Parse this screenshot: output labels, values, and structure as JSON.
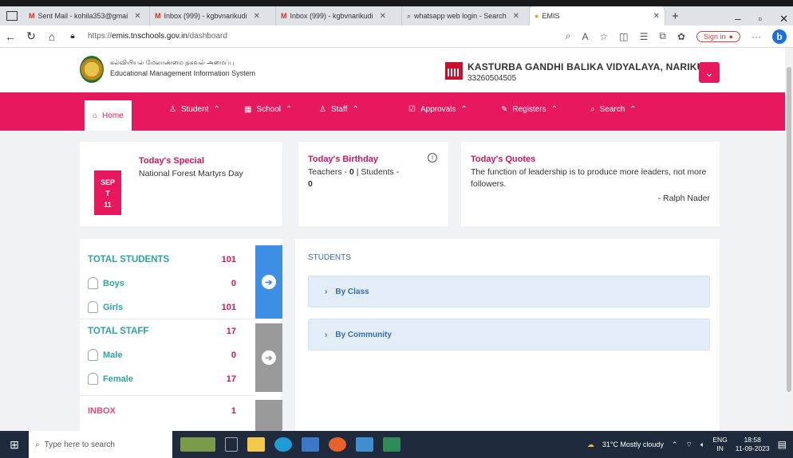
{
  "browser": {
    "tabs": [
      {
        "label": "Sent Mail - kohila353@gmai",
        "icon": "gmail-icon"
      },
      {
        "label": "Inbox (999) - kgbvnarikudi",
        "icon": "gmail-icon"
      },
      {
        "label": "Inbox (999) - kgbvnarikudi",
        "icon": "gmail-icon"
      },
      {
        "label": "whatsapp web login - Search",
        "icon": "search-icon"
      },
      {
        "label": "EMIS",
        "icon": "emis-icon",
        "active": true
      }
    ],
    "url_prefix": "https://",
    "url_host": "emis.tnschools.gov.in",
    "url_path": "/dashboard",
    "signin_label": "Sign in"
  },
  "header": {
    "org_tamil": "கல்வியியல் மேலாண்மை தகவல் அமைப்பு",
    "org_english": "Educational Management Information System",
    "school_name": "KASTURBA GANDHI BALIKA VIDYALAYA, NARIKUDI",
    "school_code": "33260504505"
  },
  "menu": {
    "home": "Home",
    "student": "Student",
    "school": "School",
    "staff": "Staff",
    "approvals": "Approvals",
    "registers": "Registers",
    "search": "Search"
  },
  "special": {
    "month": "SEP",
    "day_letter": "T",
    "day": "11",
    "title": "Today's Special",
    "text": "National Forest Martyrs Day"
  },
  "birthday": {
    "title": "Today's Birthday",
    "teachers_label": "Teachers - ",
    "teachers_count": "0",
    "students_label": "Students -",
    "students_count": "0"
  },
  "quotes": {
    "title": "Today's Quotes",
    "text": "The function of leadership is to produce more leaders, not more followers.",
    "author": "- Ralph Nader"
  },
  "stats": {
    "total_students_label": "TOTAL STUDENTS",
    "total_students": "101",
    "boys_label": "Boys",
    "boys": "0",
    "girls_label": "Girls",
    "girls": "101",
    "total_staff_label": "TOTAL STAFF",
    "total_staff": "17",
    "male_label": "Male",
    "male": "0",
    "female_label": "Female",
    "female": "17",
    "inbox_label": "INBOX",
    "inbox": "1"
  },
  "students_panel": {
    "title": "STUDENTS",
    "by_class": "By Class",
    "by_community": "By Community"
  },
  "taskbar": {
    "search_placeholder": "Type here to search",
    "weather": "31°C  Mostly cloudy",
    "lang": "ENG",
    "region": "IN",
    "time": "18:58",
    "date": "11-09-2023"
  },
  "colors": {
    "brand_pink": "#e8185f",
    "teal": "#2fa49a",
    "blue_panel": "#3d8fe6",
    "grey_panel": "#9a9a9a"
  }
}
